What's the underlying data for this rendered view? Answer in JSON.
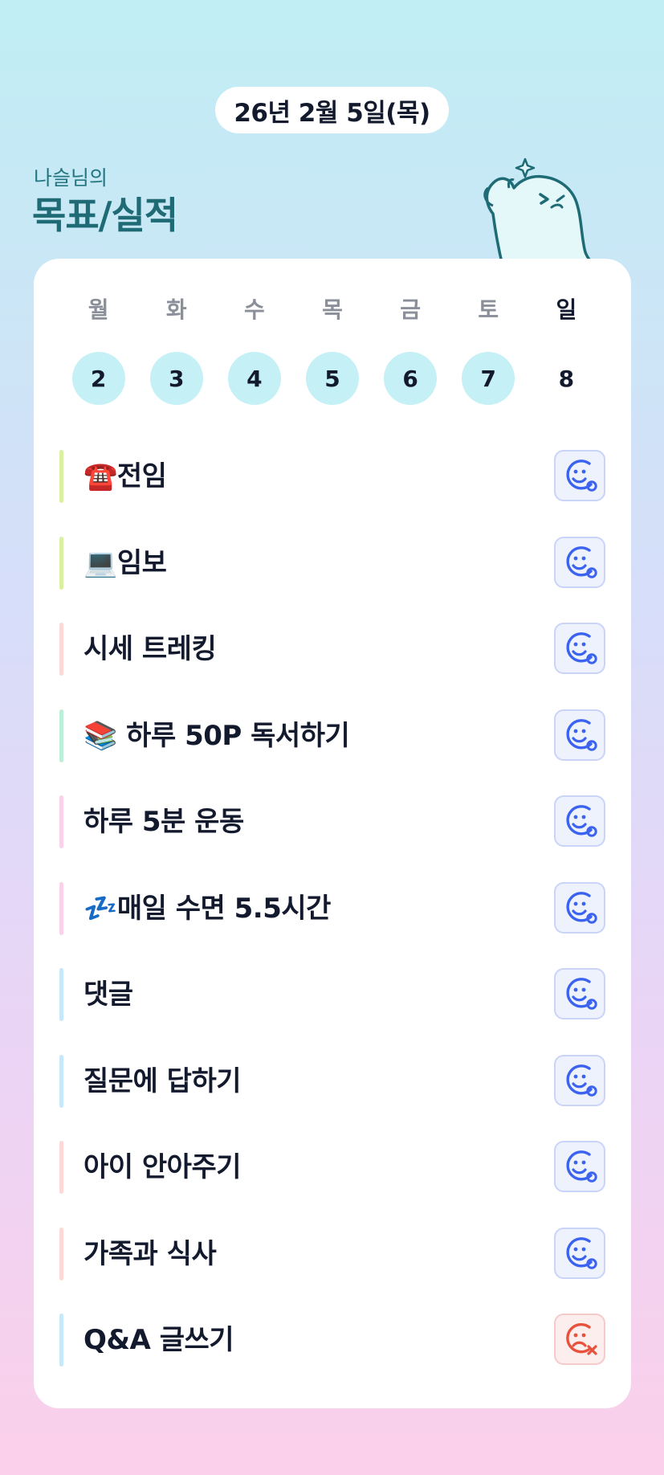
{
  "header": {
    "date": "26년 2월 5일(목)",
    "greeting": "나슬님의",
    "title": "목표/실적"
  },
  "week": {
    "day_names": [
      "월",
      "화",
      "수",
      "목",
      "금",
      "토",
      "일"
    ],
    "dates": [
      "2",
      "3",
      "4",
      "5",
      "6",
      "7",
      "8"
    ],
    "completed_days": [
      true,
      true,
      true,
      true,
      true,
      true,
      false
    ],
    "current_day_index": 6
  },
  "goals": [
    {
      "label": "☎️전임",
      "status": "success",
      "bar_color": "#d9f0a3"
    },
    {
      "label": "💻임보",
      "status": "success",
      "bar_color": "#d9f0a3"
    },
    {
      "label": "시세 트레킹",
      "status": "success",
      "bar_color": "#fcd9d6"
    },
    {
      "label": "📚 하루 50P 독서하기",
      "status": "success",
      "bar_color": "#bdeed7"
    },
    {
      "label": "하루 5분 운동",
      "status": "success",
      "bar_color": "#f9d1e8"
    },
    {
      "label": "💤매일 수면 5.5시간",
      "status": "success",
      "bar_color": "#f9d1e8"
    },
    {
      "label": "댓글",
      "status": "success",
      "bar_color": "#c7e8fb"
    },
    {
      "label": "질문에 답하기",
      "status": "success",
      "bar_color": "#c7e8fb"
    },
    {
      "label": "아이 안아주기",
      "status": "success",
      "bar_color": "#fcd9d6"
    },
    {
      "label": "가족과 식사",
      "status": "success",
      "bar_color": "#fcd9d6"
    },
    {
      "label": "Q&A 글쓰기",
      "status": "fail",
      "bar_color": "#c7e8fb"
    }
  ],
  "colors": {
    "success_icon": "#3b63f0",
    "fail_icon": "#e8513c",
    "done_day": "#c5f0f6",
    "title": "#1e6a75"
  },
  "icons": {
    "success": "smile-check-icon",
    "fail": "frown-x-icon",
    "mascot": "mascot-character"
  }
}
